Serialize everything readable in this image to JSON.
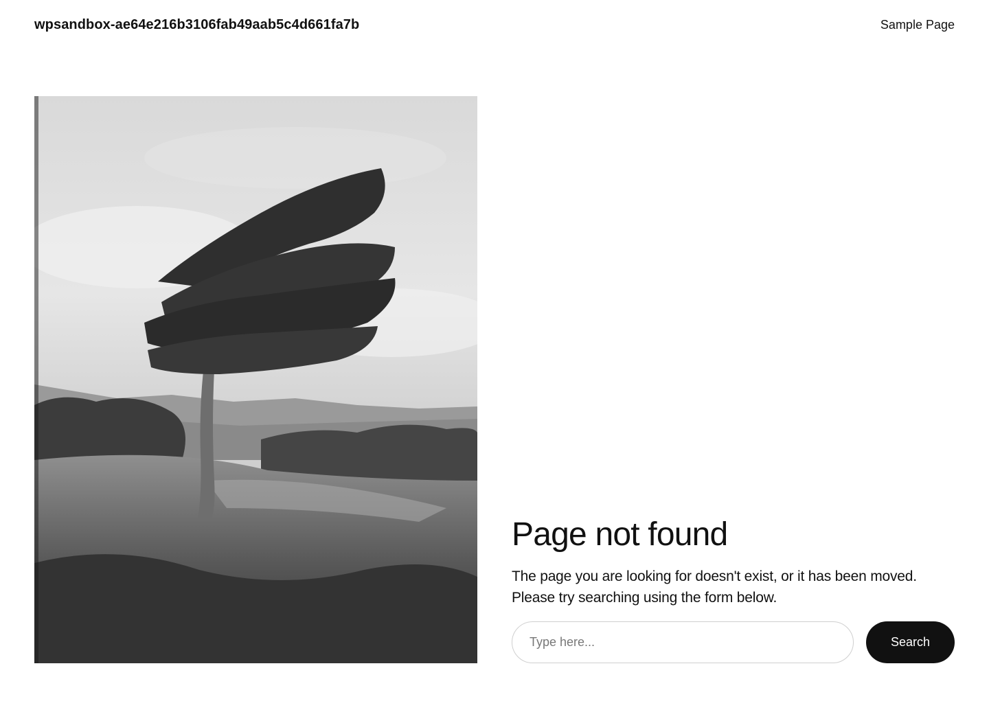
{
  "header": {
    "site_title": "wpsandbox-ae64e216b3106fab49aab5c4d661fa7b",
    "nav_items": [
      {
        "label": "Sample Page"
      }
    ]
  },
  "featured_image": {
    "description_icon": "photo-windswept-tree-icon"
  },
  "main": {
    "title": "Page not found",
    "message_line1": "The page you are looking for doesn't exist, or it has been moved.",
    "message_line2": "Please try searching using the form below."
  },
  "search": {
    "placeholder": "Type here...",
    "value": "",
    "button_label": "Search"
  },
  "colors": {
    "text": "#111111",
    "button_bg": "#111111",
    "button_text": "#ffffff",
    "input_border": "#cfcfcf"
  }
}
